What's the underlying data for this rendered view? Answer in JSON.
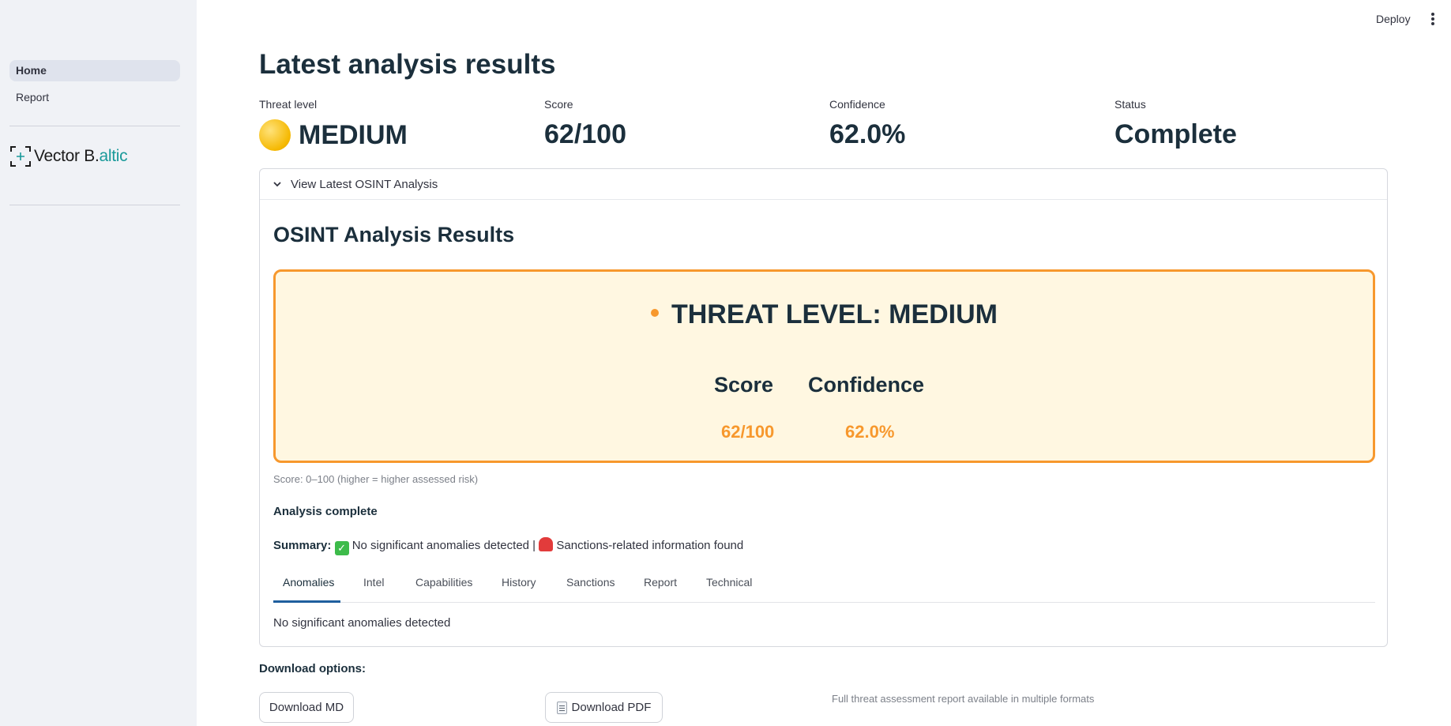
{
  "sidebar": {
    "nav": [
      {
        "label": "Home",
        "active": true
      },
      {
        "label": "Report",
        "active": false
      }
    ],
    "logo": {
      "text_main": "Vector B.",
      "text_accent": "altic",
      "accent_color": "#1a9a9a"
    }
  },
  "header": {
    "deploy_label": "Deploy",
    "menu_icon": "kebab-menu-icon"
  },
  "main": {
    "title": "Latest analysis results",
    "metrics": [
      {
        "label": "Threat level",
        "value": "MEDIUM",
        "icon": "yellow-circle-icon"
      },
      {
        "label": "Score",
        "value": "62/100"
      },
      {
        "label": "Confidence",
        "value": "62.0%"
      },
      {
        "label": "Status",
        "value": "Complete"
      }
    ],
    "expander": {
      "title": "View Latest OSINT Analysis",
      "expanded": true,
      "section_title": "OSINT Analysis Results",
      "threat_card": {
        "heading": "THREAT LEVEL: MEDIUM",
        "accent_color": "#f7982d",
        "score_label": "Score",
        "score_value": "62/100",
        "confidence_label": "Confidence",
        "confidence_value": "62.0%"
      },
      "caption": "Score: 0–100 (higher = higher assessed risk)",
      "analysis_status": "Analysis complete",
      "summary": {
        "label": "Summary:",
        "item1": "No significant anomalies detected",
        "separator": "|",
        "item2": "Sanctions-related information found"
      },
      "tabs": [
        "Anomalies",
        "Intel",
        "Capabilities",
        "History",
        "Sanctions",
        "Report",
        "Technical"
      ],
      "active_tab": "Anomalies",
      "tab_content": "No significant anomalies detected"
    },
    "downloads": {
      "label": "Download options:",
      "md_button": "Download MD",
      "pdf_button": "Download PDF",
      "note": "Full threat assessment report available in multiple formats"
    }
  }
}
